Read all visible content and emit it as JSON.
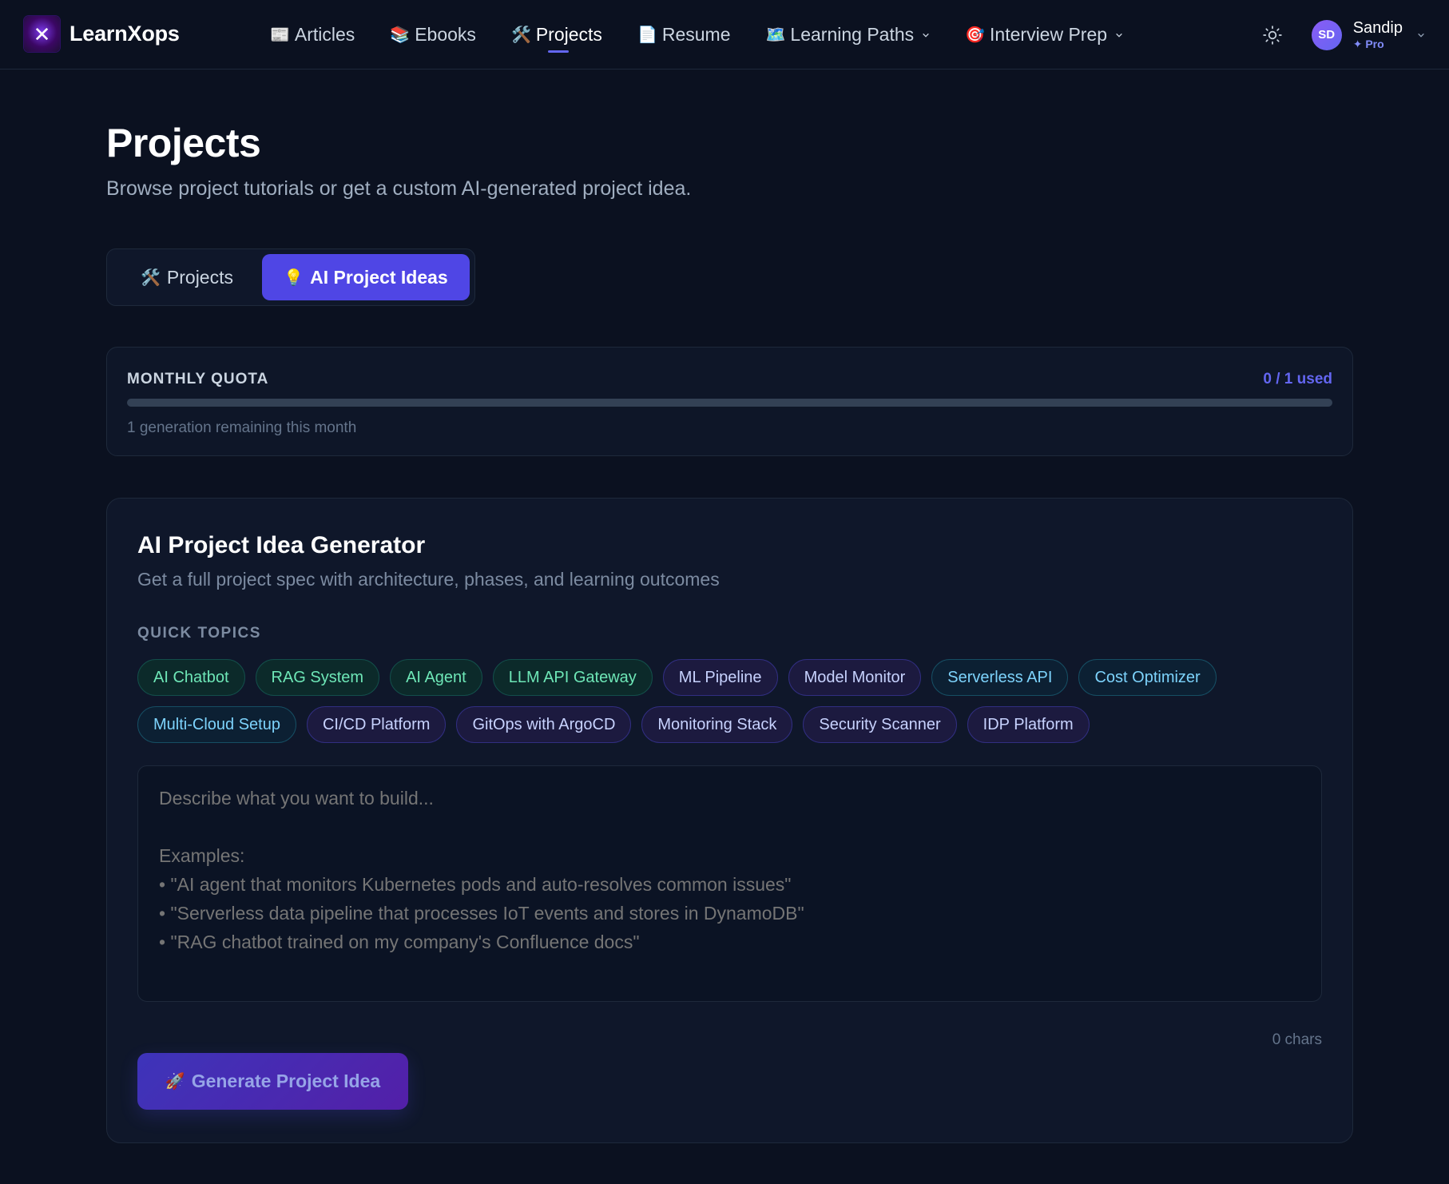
{
  "brand": {
    "name": "LearnXops",
    "logo_glyph": "✕"
  },
  "nav": {
    "items": [
      {
        "icon": "📰",
        "label": "Articles"
      },
      {
        "icon": "📚",
        "label": "Ebooks"
      },
      {
        "icon": "🛠️",
        "label": "Projects",
        "active": true
      },
      {
        "icon": "📄",
        "label": "Resume"
      },
      {
        "icon": "🗺️",
        "label": "Learning Paths",
        "dropdown": true
      },
      {
        "icon": "🎯",
        "label": "Interview Prep",
        "dropdown": true
      }
    ]
  },
  "user": {
    "initials": "SD",
    "name": "Sandip",
    "plan": "✦ Pro"
  },
  "page": {
    "title": "Projects",
    "subtitle": "Browse project tutorials or get a custom AI-generated project idea."
  },
  "tabs": [
    {
      "icon": "🛠️",
      "label": "Projects",
      "active": false
    },
    {
      "icon": "💡",
      "label": "AI Project Ideas",
      "active": true
    }
  ],
  "quota": {
    "label": "MONTHLY QUOTA",
    "used_text": "0 / 1 used",
    "used": 0,
    "total": 1,
    "remaining_text": "1 generation remaining this month"
  },
  "generator": {
    "title": "AI Project Idea Generator",
    "subtitle": "Get a full project spec with architecture, phases, and learning outcomes",
    "quick_topics_label": "QUICK TOPICS",
    "topics": [
      {
        "label": "AI Chatbot",
        "tone": "green"
      },
      {
        "label": "RAG System",
        "tone": "green"
      },
      {
        "label": "AI Agent",
        "tone": "green"
      },
      {
        "label": "LLM API Gateway",
        "tone": "green"
      },
      {
        "label": "ML Pipeline",
        "tone": "purple"
      },
      {
        "label": "Model Monitor",
        "tone": "purple"
      },
      {
        "label": "Serverless API",
        "tone": "blue"
      },
      {
        "label": "Cost Optimizer",
        "tone": "blue"
      },
      {
        "label": "Multi-Cloud Setup",
        "tone": "blue"
      },
      {
        "label": "CI/CD Platform",
        "tone": "purple"
      },
      {
        "label": "GitOps with ArgoCD",
        "tone": "purple"
      },
      {
        "label": "Monitoring Stack",
        "tone": "purple"
      },
      {
        "label": "Security Scanner",
        "tone": "purple"
      },
      {
        "label": "IDP Platform",
        "tone": "purple"
      }
    ],
    "textarea_value": "",
    "textarea_placeholder": "Describe what you want to build...\n\nExamples:\n• \"AI agent that monitors Kubernetes pods and auto-resolves common issues\"\n• \"Serverless data pipeline that processes IoT events and stores in DynamoDB\"\n• \"RAG chatbot trained on my company's Confluence docs\"",
    "char_count": "0 chars",
    "button_icon": "🚀",
    "button_label": "Generate Project Idea"
  },
  "colors": {
    "accent": "#6366f1",
    "background": "#0b1120",
    "card": "#0f172a"
  }
}
